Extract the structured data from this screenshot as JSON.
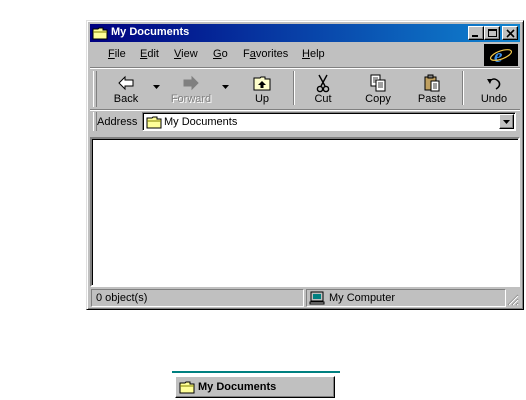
{
  "window": {
    "title": "My Documents",
    "title_gradient": [
      "#000080",
      "#1084d0"
    ]
  },
  "menu": {
    "items": [
      {
        "label": "File",
        "accel": "F",
        "rest": "ile"
      },
      {
        "label": "Edit",
        "accel": "E",
        "rest": "dit"
      },
      {
        "label": "View",
        "accel": "V",
        "rest": "iew"
      },
      {
        "label": "Go",
        "accel": "G",
        "rest": "o"
      },
      {
        "label": "Favorites",
        "accel": "a",
        "pre": "F",
        "rest": "vorites"
      },
      {
        "label": "Help",
        "accel": "H",
        "rest": "elp"
      }
    ]
  },
  "toolbar": {
    "back": "Back",
    "forward": "Forward",
    "up": "Up",
    "cut": "Cut",
    "copy": "Copy",
    "paste": "Paste",
    "undo": "Undo"
  },
  "address": {
    "label": "Address",
    "value": "My Documents"
  },
  "status": {
    "objects": "0 object(s)",
    "zone": "My Computer"
  },
  "taskbar": {
    "button_label": "My Documents"
  },
  "icons": {
    "folder": "folder-icon",
    "ie": "internet-explorer-logo",
    "back": "back-arrow-icon",
    "forward": "forward-arrow-icon",
    "up": "up-folder-icon",
    "cut": "scissors-icon",
    "copy": "copy-icon",
    "paste": "paste-icon",
    "undo": "undo-icon",
    "computer": "computer-icon"
  },
  "colors": {
    "face": "#c0c0c0",
    "title_active": "#000080",
    "folder_yellow": "#ffff99",
    "taskbar_line": "#008080"
  }
}
